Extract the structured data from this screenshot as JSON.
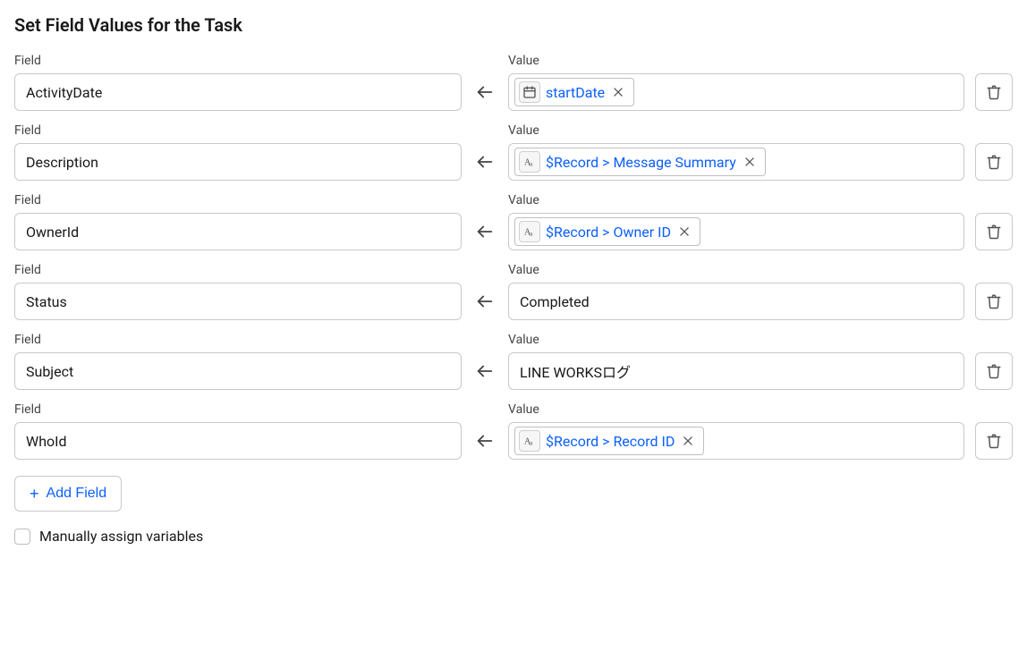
{
  "title": "Set Field Values for the Task",
  "labels": {
    "field": "Field",
    "value": "Value"
  },
  "rows": [
    {
      "field": "ActivityDate",
      "valueType": "pill",
      "pillIcon": "date",
      "pillText": "startDate"
    },
    {
      "field": "Description",
      "valueType": "pill",
      "pillIcon": "text",
      "pillText": "$Record > Message Summary"
    },
    {
      "field": "OwnerId",
      "valueType": "pill",
      "pillIcon": "text",
      "pillText": "$Record > Owner ID"
    },
    {
      "field": "Status",
      "valueType": "plain",
      "plainText": "Completed"
    },
    {
      "field": "Subject",
      "valueType": "plain",
      "plainText": "LINE WORKSログ"
    },
    {
      "field": "WhoId",
      "valueType": "pill",
      "pillIcon": "text",
      "pillText": "$Record > Record ID"
    }
  ],
  "addField": "Add Field",
  "manualAssign": "Manually assign variables"
}
